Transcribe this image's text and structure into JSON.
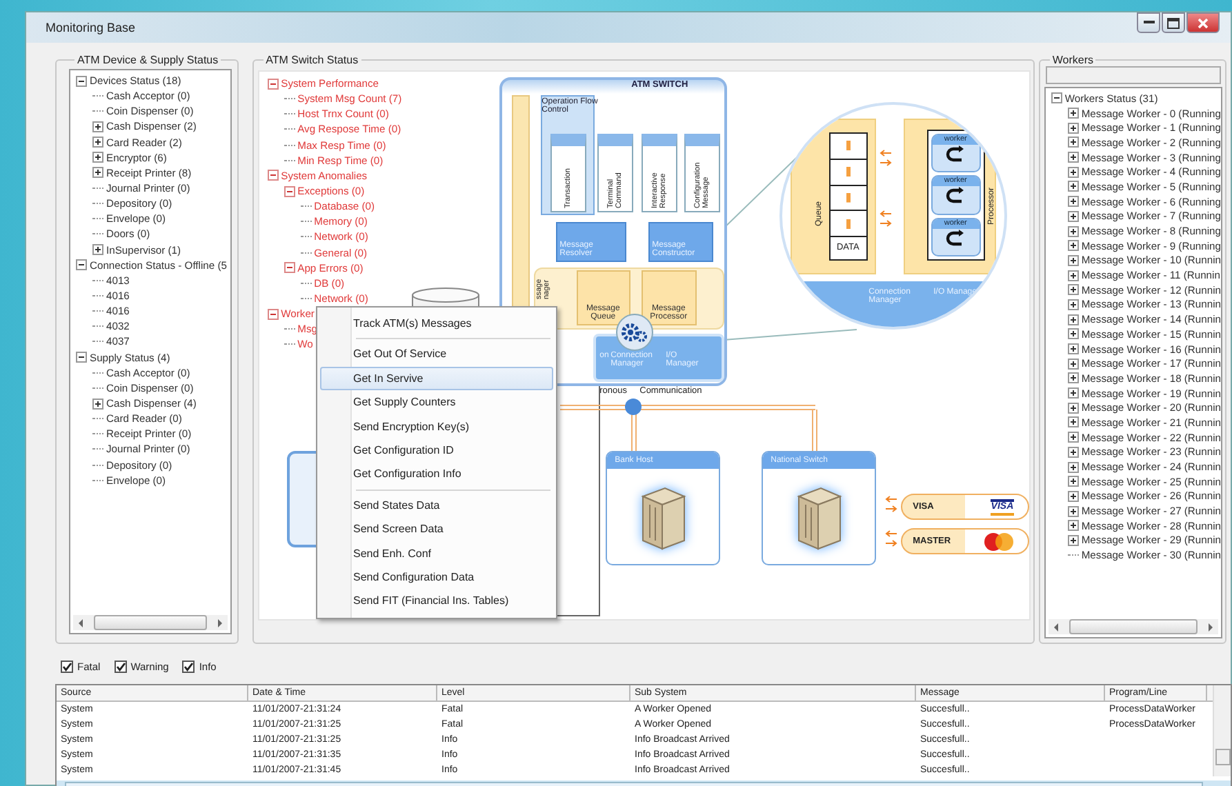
{
  "window": {
    "title": "Monitoring Base"
  },
  "device_panel": {
    "title": "ATM Device & Supply Status",
    "tree": [
      {
        "label": "Devices Status (18)",
        "expanded": true,
        "children": [
          {
            "label": "Cash Acceptor (0)"
          },
          {
            "label": "Coin Dispenser (0)"
          },
          {
            "label": "Cash Dispenser (2)",
            "expanded": false
          },
          {
            "label": "Card Reader (2)",
            "expanded": false
          },
          {
            "label": "Encryptor (6)",
            "expanded": false
          },
          {
            "label": "Receipt Printer (8)",
            "expanded": false
          },
          {
            "label": "Journal Printer (0)"
          },
          {
            "label": "Depository (0)"
          },
          {
            "label": "Envelope (0)"
          },
          {
            "label": "Doors (0)"
          },
          {
            "label": "InSupervisor (1)",
            "expanded": false
          }
        ]
      },
      {
        "label": "Connection Status - Offline (5",
        "expanded": true,
        "children": [
          {
            "label": "4013"
          },
          {
            "label": "4016"
          },
          {
            "label": "4016"
          },
          {
            "label": "4032"
          },
          {
            "label": "4037"
          }
        ]
      },
      {
        "label": "Supply Status (4)",
        "expanded": true,
        "children": [
          {
            "label": "Cash Acceptor (0)"
          },
          {
            "label": "Coin Dispenser (0)"
          },
          {
            "label": "Cash Dispenser (4)",
            "expanded": false
          },
          {
            "label": "Card Reader (0)"
          },
          {
            "label": "Receipt Printer (0)"
          },
          {
            "label": "Journal Printer (0)"
          },
          {
            "label": "Depository (0)"
          },
          {
            "label": "Envelope (0)"
          }
        ]
      }
    ]
  },
  "switch_panel": {
    "title": "ATM Switch Status",
    "tree": [
      {
        "label": "System Performance",
        "expanded": true,
        "children": [
          {
            "label": "System Msg Count (7)"
          },
          {
            "label": "Host Trnx Count (0)"
          },
          {
            "label": "Avg Respose Time (0)"
          },
          {
            "label": "Max Resp Time (0)"
          },
          {
            "label": "Min Resp Time (0)"
          }
        ]
      },
      {
        "label": "System Anomalies",
        "expanded": true,
        "children": [
          {
            "label": "Exceptions (0)",
            "expanded": true,
            "children": [
              {
                "label": "Database (0)"
              },
              {
                "label": "Memory (0)"
              },
              {
                "label": "Network (0)"
              },
              {
                "label": "General (0)"
              }
            ]
          },
          {
            "label": "App Errors (0)",
            "expanded": true,
            "children": [
              {
                "label": "DB (0)"
              },
              {
                "label": "Network (0)"
              }
            ]
          }
        ]
      },
      {
        "label": "Worker",
        "expanded": true,
        "children": [
          {
            "label": "Msg"
          },
          {
            "label": "Wo"
          }
        ]
      }
    ],
    "diagram": {
      "title": "ATM SWITCH",
      "flow_control": "Operation Flow Control",
      "modules": [
        "Transaction",
        "Terminal Command",
        "Interactive Response",
        "Configuration Message"
      ],
      "resolver": "Message Resolver",
      "constructor": "Message Constructor",
      "manager": "ssage nager",
      "queue": "Message Queue",
      "processor": "Message Processor",
      "band_labels": [
        "on",
        "Connection Manager",
        "I/O Manager"
      ],
      "link_labels": [
        "ronous",
        "Communication"
      ],
      "hosts": [
        {
          "label": "Bank Host"
        },
        {
          "label": "National Switch"
        }
      ],
      "cards": [
        {
          "label": "VISA",
          "kind": "visa",
          "logo_text": "VISA"
        },
        {
          "label": "MASTER",
          "kind": "circles"
        }
      ],
      "zoom": {
        "queue_label": "Queue",
        "data_label": "DATA",
        "workers": [
          "worker",
          "worker",
          "worker"
        ],
        "processor_label": "Processor",
        "band_labels": [
          "Connection Manager",
          "I/O Manage"
        ]
      }
    }
  },
  "context_menu": {
    "groups": [
      [
        {
          "label": "Track ATM(s) Messages",
          "selected": false
        }
      ],
      [
        {
          "label": "Get Out Of Service",
          "selected": false
        },
        {
          "label": "Get In Servive",
          "selected": true
        },
        {
          "label": "Get Supply Counters",
          "selected": false
        },
        {
          "label": "Send Encryption Key(s)",
          "selected": false
        },
        {
          "label": "Get Configuration ID",
          "selected": false
        },
        {
          "label": "Get Configuration Info",
          "selected": false
        }
      ],
      [
        {
          "label": "Send States Data",
          "selected": false
        },
        {
          "label": "Send Screen Data",
          "selected": false
        },
        {
          "label": "Send Enh. Conf",
          "selected": false
        },
        {
          "label": "Send Configuration Data",
          "selected": false
        },
        {
          "label": "Send FIT (Financial Ins. Tables)",
          "selected": false
        }
      ]
    ]
  },
  "workers_panel": {
    "title": "Workers",
    "tree": [
      {
        "label": "Workers Status (31)",
        "expanded": true,
        "children": [
          {
            "label": "Message Worker - 0 (Running",
            "expanded": false
          },
          {
            "label": "Message Worker - 1 (Running",
            "expanded": false
          },
          {
            "label": "Message Worker - 2 (Running",
            "expanded": false
          },
          {
            "label": "Message Worker - 3 (Running",
            "expanded": false
          },
          {
            "label": "Message Worker - 4 (Running",
            "expanded": false
          },
          {
            "label": "Message Worker - 5 (Running",
            "expanded": false
          },
          {
            "label": "Message Worker - 6 (Running",
            "expanded": false
          },
          {
            "label": "Message Worker - 7 (Running",
            "expanded": false
          },
          {
            "label": "Message Worker - 8 (Running",
            "expanded": false
          },
          {
            "label": "Message Worker - 9 (Running",
            "expanded": false
          },
          {
            "label": "Message Worker - 10 (Runnin",
            "expanded": false
          },
          {
            "label": "Message Worker - 11 (Runnin",
            "expanded": false
          },
          {
            "label": "Message Worker - 12 (Runnin",
            "expanded": false
          },
          {
            "label": "Message Worker - 13 (Runnin",
            "expanded": false
          },
          {
            "label": "Message Worker - 14 (Runnin",
            "expanded": false
          },
          {
            "label": "Message Worker - 15 (Runnin",
            "expanded": false
          },
          {
            "label": "Message Worker - 16 (Runnin",
            "expanded": false
          },
          {
            "label": "Message Worker - 17 (Runnin",
            "expanded": false
          },
          {
            "label": "Message Worker - 18 (Runnin",
            "expanded": false
          },
          {
            "label": "Message Worker - 19 (Runnin",
            "expanded": false
          },
          {
            "label": "Message Worker - 20 (Runnin",
            "expanded": false
          },
          {
            "label": "Message Worker - 21 (Runnin",
            "expanded": false
          },
          {
            "label": "Message Worker - 22 (Runnin",
            "expanded": false
          },
          {
            "label": "Message Worker - 23 (Runnin",
            "expanded": false
          },
          {
            "label": "Message Worker - 24 (Runnin",
            "expanded": false
          },
          {
            "label": "Message Worker - 25 (Runnin",
            "expanded": false
          },
          {
            "label": "Message Worker - 26 (Runnin",
            "expanded": false
          },
          {
            "label": "Message Worker - 27 (Runnin",
            "expanded": false
          },
          {
            "label": "Message Worker - 28 (Runnin",
            "expanded": false
          },
          {
            "label": "Message Worker - 29 (Runnin",
            "expanded": false
          },
          {
            "label": "Message Worker - 30 (Runnin"
          }
        ]
      }
    ]
  },
  "filters": [
    {
      "label": "Fatal",
      "checked": true
    },
    {
      "label": "Warning",
      "checked": true
    },
    {
      "label": "Info",
      "checked": true
    }
  ],
  "log": {
    "columns": [
      "Source",
      "Date & Time",
      "Level",
      "Sub System",
      "Message",
      "Program/Line"
    ],
    "rows": [
      [
        "System",
        "11/01/2007-21:31:24",
        "Fatal",
        "A Worker Opened",
        "Succesfull..",
        "ProcessDataWorker"
      ],
      [
        "System",
        "11/01/2007-21:31:25",
        "Fatal",
        "A Worker Opened",
        "Succesfull..",
        "ProcessDataWorker"
      ],
      [
        "System",
        "11/01/2007-21:31:25",
        "Info",
        "Info Broadcast Arrived",
        "Succesfull..",
        ""
      ],
      [
        "System",
        "11/01/2007-21:31:35",
        "Info",
        "Info Broadcast Arrived",
        "Succesfull..",
        ""
      ],
      [
        "System",
        "11/01/2007-21:31:45",
        "Info",
        "Info Broadcast Arrived",
        "Succesfull..",
        ""
      ]
    ]
  }
}
